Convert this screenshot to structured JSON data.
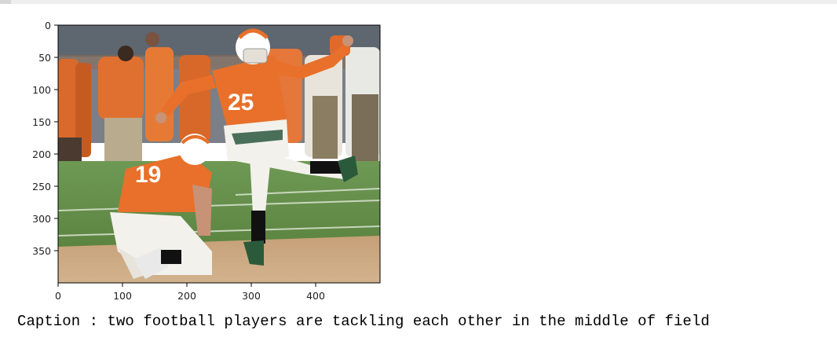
{
  "figure": {
    "x_ticks": [
      "0",
      "100",
      "200",
      "300",
      "400"
    ],
    "y_ticks": [
      "0",
      "50",
      "100",
      "150",
      "200",
      "250",
      "300",
      "350"
    ],
    "image_subject": "football-kicker-and-holder-photo",
    "jersey_numbers": [
      "25",
      "19"
    ]
  },
  "caption": {
    "text": "Caption : two football players are tackling each other in the middle of field"
  },
  "colors": {
    "jersey_orange": "#e8702a",
    "field_green": "#5f8a45",
    "dirt": "#c8a47a",
    "stands_gray": "#6d7480"
  }
}
